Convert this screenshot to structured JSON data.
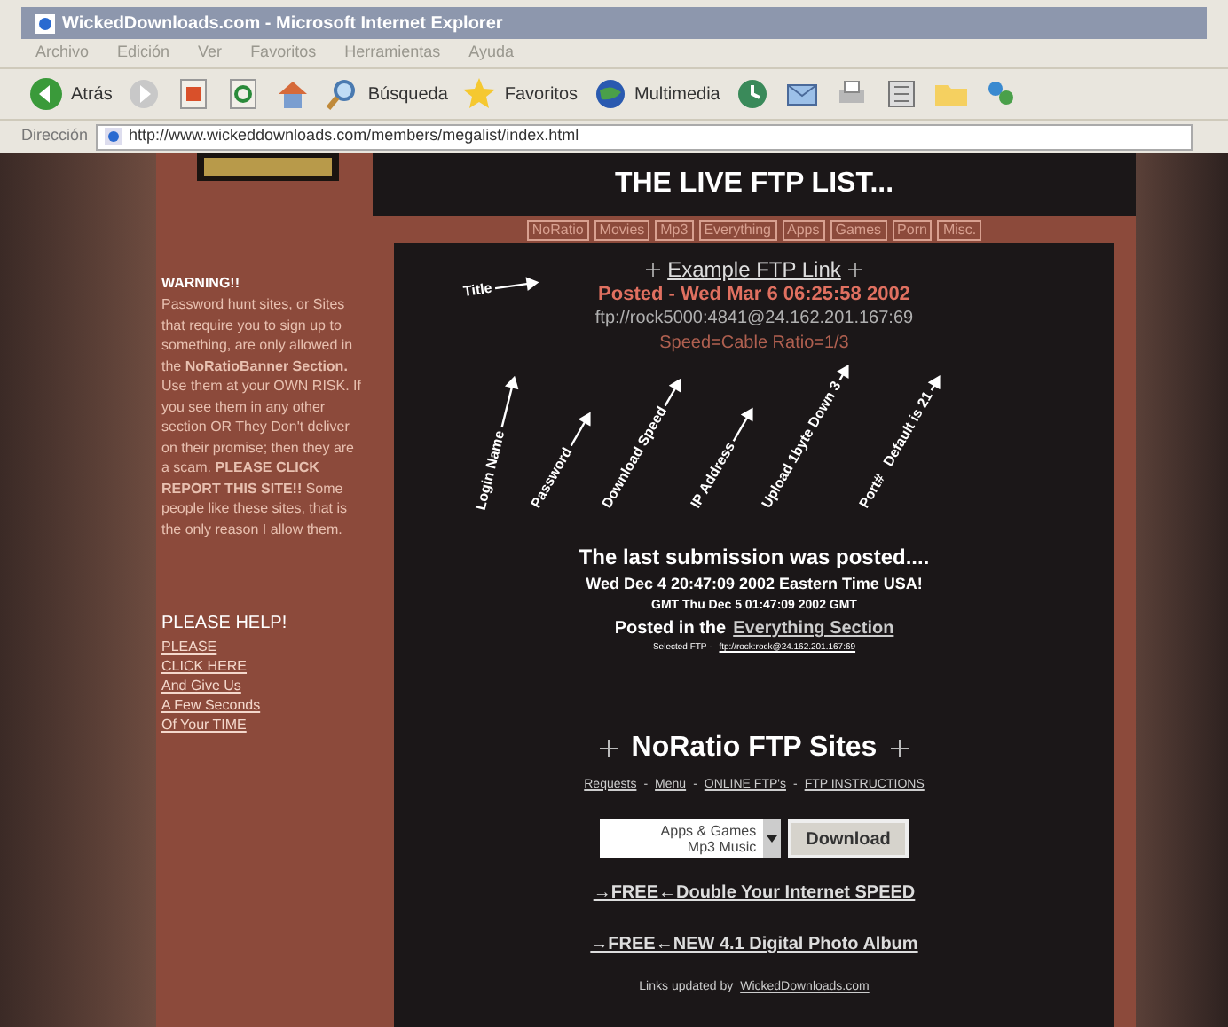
{
  "window": {
    "title": "WickedDownloads.com - Microsoft Internet Explorer"
  },
  "menu": [
    "Archivo",
    "Edición",
    "Ver",
    "Favoritos",
    "Herramientas",
    "Ayuda"
  ],
  "toolbar": [
    {
      "kind": "back",
      "label": "Atrás"
    },
    {
      "kind": "forward"
    },
    {
      "kind": "stop"
    },
    {
      "kind": "refresh"
    },
    {
      "kind": "home"
    },
    {
      "kind": "search",
      "label": "Búsqueda"
    },
    {
      "kind": "favorites",
      "label": "Favoritos"
    },
    {
      "kind": "media",
      "label": "Multimedia"
    },
    {
      "kind": "history"
    },
    {
      "kind": "mail"
    },
    {
      "kind": "print"
    },
    {
      "kind": "edit"
    },
    {
      "kind": "folder"
    },
    {
      "kind": "messenger"
    }
  ],
  "address": {
    "label": "Dirección",
    "value": "http://www.wickeddownloads.com/members/megalist/index.html"
  },
  "sidebar": {
    "warning_title": "WARNING!!",
    "warning_parts": [
      "Password hunt sites, or Sites that require you to sign up to something, are only allowed in the **NoRatioBanner Section.** Use them at your OWN RISK. If you see them in any other section OR They Don't deliver on their promise; then they are a scam. **PLEASE CLICK REPORT THIS SITE!!** Some people like these sites, that is the only reason I allow them."
    ],
    "help_title": "PLEASE HELP!",
    "help_links": [
      "PLEASE",
      "CLICK HERE",
      "And Give Us",
      "A Few Seconds",
      "Of Your TIME"
    ]
  },
  "header": {
    "title": "THE LIVE FTP LIST..."
  },
  "nav": [
    "NoRatio",
    "Movies",
    "Mp3",
    "Everything",
    "Apps",
    "Games",
    "Porn",
    "Misc."
  ],
  "example": {
    "title": "Example FTP Link",
    "posted": "Posted - Wed Mar 6 06:25:58 2002",
    "ftp": "ftp://rock5000:4841@24.162.201.167:69",
    "speed": "Speed=Cable Ratio=1/3",
    "annotations": [
      "Title",
      "Login Name",
      "Password",
      "Download Speed",
      "IP Address",
      "Upload 1byte Down 3",
      "Port#   Default is 21"
    ]
  },
  "last": {
    "title": "The last submission was posted....",
    "time": "Wed Dec 4 20:47:09 2002 Eastern Time USA!",
    "gmt": "GMT Thu Dec 5 01:47:09 2002 GMT",
    "posted_prefix": "Posted in the",
    "posted_link": "Everything Section",
    "selected_prefix": "Selected FTP -",
    "selected_link": "ftp://rock:rock@24.162.201.167:69"
  },
  "noratio": {
    "title": "NoRatio FTP Sites",
    "links": [
      "Requests",
      "Menu",
      "ONLINE FTP's",
      "FTP INSTRUCTIONS"
    ],
    "separator": "-",
    "select_options": [
      "Apps & Games",
      "Mp3 Music"
    ],
    "button": "Download",
    "promos": [
      "→FREE←Double Your Internet SPEED",
      "→FREE←NEW 4.1 Digital Photo Album"
    ],
    "updated_prefix": "Links updated by",
    "updated_link": "WickedDownloads.com"
  }
}
